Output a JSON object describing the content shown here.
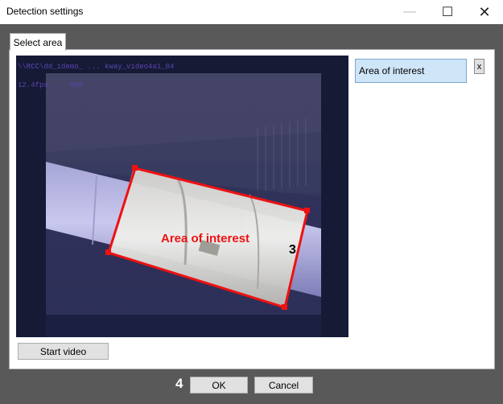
{
  "window": {
    "title": "Detection settings",
    "minimize_glyph": "—",
    "maximize_glyph": "☐",
    "close_glyph": "✕"
  },
  "tabs": [
    {
      "label": "Select area",
      "active": true
    }
  ],
  "video": {
    "overlay_path": "\\\\RCC\\dd_1demo_ ... kway_video4a1_04",
    "overlay_fps": "12.4fps ... 000",
    "area_label": "Area of interest",
    "area_step": "3",
    "outline_color": "#ee1111"
  },
  "areas_list": {
    "items": [
      {
        "label": "Area of interest",
        "selected": true
      }
    ],
    "remove_label": "x"
  },
  "buttons": {
    "start_video": "Start video",
    "ok": "OK",
    "cancel": "Cancel"
  },
  "annotations": {
    "step_ok": "4"
  },
  "colors": {
    "accent_selected": "#cfe5f8",
    "frame": "#595959",
    "area_outline": "#ee1111"
  }
}
